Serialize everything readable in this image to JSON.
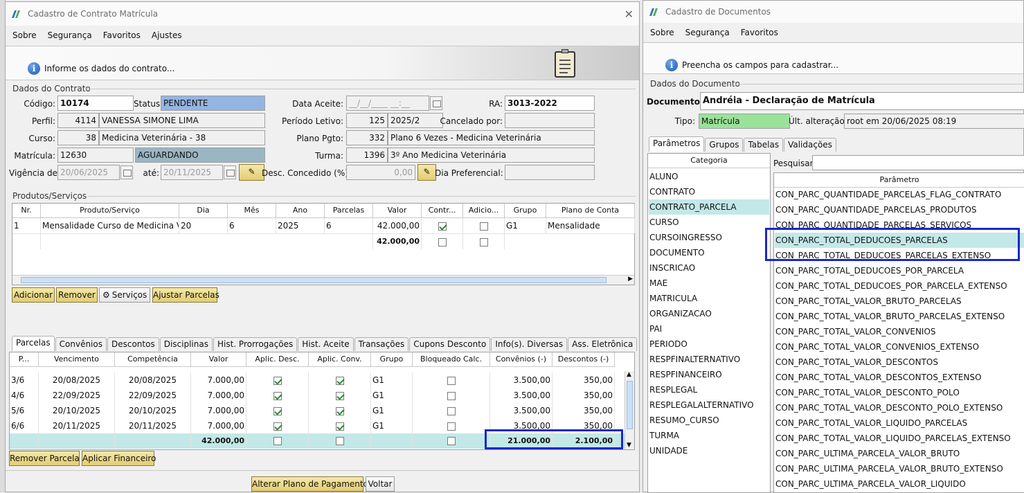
{
  "left": {
    "title": "Cadastro de Contrato Matrícula",
    "menu": [
      "Sobre",
      "Segurança",
      "Favoritos",
      "Ajustes"
    ],
    "banner": "Informe os dados do contrato...",
    "section_contract": "Dados do Contrato",
    "fields": {
      "codigo_label": "Código:",
      "codigo": "10174",
      "status_label": "Status:",
      "status": "PENDENTE",
      "data_aceite_label": "Data Aceite:",
      "data_aceite": "__/__/____ __:__",
      "ra_label": "RA:",
      "ra": "3013-2022",
      "perfil_label": "Perfil:",
      "perfil_id": "4114",
      "perfil_nome": "VANESSA SIMONE LIMA",
      "periodo_label": "Período Letivo:",
      "periodo_id": "125",
      "periodo": "2025/2",
      "cancelado_label": "Cancelado por:",
      "cancelado": "",
      "curso_label": "Curso:",
      "curso_id": "38",
      "curso": "Medicina Veterinária - 38",
      "plano_label": "Plano Pgto:",
      "plano_id": "332",
      "plano": "Plano 6 Vezes - Medicina Veterinária",
      "matricula_label": "Matrícula:",
      "matricula": "12630",
      "matricula_status": "AGUARDANDO",
      "turma_label": "Turma:",
      "turma_id": "1396",
      "turma": "3º Ano Medicina Veterinária",
      "vigencia_label": "Vigência de:",
      "vigencia_de": "20/06/2025",
      "ate_label": "até:",
      "vigencia_ate": "20/11/2025",
      "desc_label": "Desc. Concedido (%):",
      "desc": "0,00",
      "dia_pref_label": "Dia Preferencial:",
      "dia_pref": ""
    },
    "section_products": "Produtos/Serviços",
    "products_headers": [
      "Nr.",
      "Produto/Serviço",
      "Dia",
      "Mês",
      "Ano",
      "Parcelas",
      "Valor",
      "Contr...",
      "Adicio...",
      "Grupo",
      "Plano de Conta"
    ],
    "products_rows": [
      {
        "nr": "1",
        "produto": "Mensalidade Curso de Medicina Ve...",
        "dia": "20",
        "mes": "6",
        "ano": "2025",
        "parcelas": "6",
        "valor": "42.000,00",
        "contr": true,
        "adic": false,
        "grupo": "G1",
        "plano": "Mensalidade"
      }
    ],
    "products_total": "42.000,00",
    "product_buttons": [
      "Adicionar",
      "Remover",
      "Serviços",
      "Ajustar Parcelas"
    ],
    "tabs": [
      "Parcelas",
      "Convênios",
      "Descontos",
      "Disciplinas",
      "Hist. Prorrogações",
      "Hist. Aceite",
      "Transações",
      "Cupons Desconto",
      "Info(s). Diversas",
      "Ass. Eletrônica"
    ],
    "parcelas_headers": [
      "P...",
      "Vencimento",
      "Competência",
      "Valor",
      "Aplic. Desc.",
      "Aplic. Conv.",
      "Grupo",
      "Bloqueado Calc.",
      "Convênios (-)",
      "Descontos (-)"
    ],
    "parcelas_rows": [
      {
        "p": "3/6",
        "venc": "20/08/2025",
        "comp": "20/08/2025",
        "valor": "7.000,00",
        "desc": true,
        "conv": true,
        "grupo": "G1",
        "bloq": false,
        "convenios": "3.500,00",
        "descontos": "350,00"
      },
      {
        "p": "4/6",
        "venc": "22/09/2025",
        "comp": "22/09/2025",
        "valor": "7.000,00",
        "desc": true,
        "conv": true,
        "grupo": "G1",
        "bloq": false,
        "convenios": "3.500,00",
        "descontos": "350,00"
      },
      {
        "p": "5/6",
        "venc": "20/10/2025",
        "comp": "20/10/2025",
        "valor": "7.000,00",
        "desc": true,
        "conv": true,
        "grupo": "G1",
        "bloq": false,
        "convenios": "3.500,00",
        "descontos": "350,00"
      },
      {
        "p": "6/6",
        "venc": "20/11/2025",
        "comp": "20/11/2025",
        "valor": "7.000,00",
        "desc": true,
        "conv": true,
        "grupo": "G1",
        "bloq": false,
        "convenios": "3.500,00",
        "descontos": "350,00"
      }
    ],
    "parcelas_total": {
      "valor": "42.000,00",
      "convenios": "21.000,00",
      "descontos": "2.100,00"
    },
    "parcela_buttons": [
      "Remover Parcela",
      "Aplicar Financeiro"
    ],
    "footer_buttons": [
      "Alterar Plano de Pagamento",
      "Voltar"
    ]
  },
  "right": {
    "title": "Cadastro de Documentos",
    "menu": [
      "Sobre",
      "Segurança",
      "Favoritos"
    ],
    "banner": "Preencha os campos para cadastrar...",
    "section": "Dados do Documento",
    "documento_label": "Documento:",
    "documento": "Andréia - Declaração de Matrícula",
    "tipo_label": "Tipo:",
    "tipo": "Matrícula",
    "ult_label": "Últ. alteração:",
    "ult": "root em 20/06/2025 08:19",
    "tabs": [
      "Parâmetros",
      "Grupos",
      "Tabelas",
      "Validações"
    ],
    "categoria_header": "Categoria",
    "categorias": [
      "ALUNO",
      "CONTRATO",
      "CONTRATO_PARCELA",
      "CURSO",
      "CURSOINGRESSO",
      "DOCUMENTO",
      "INSCRICAO",
      "MAE",
      "MATRICULA",
      "ORGANIZACAO",
      "PAI",
      "PERIODO",
      "RESPFINALTERNATIVO",
      "RESPFINANCEIRO",
      "RESPLEGAL",
      "RESPLEGALALTERNATIVO",
      "RESUMO_CURSO",
      "TURMA",
      "UNIDADE"
    ],
    "pesquisar_label": "Pesquisar:",
    "parametro_header": "Parâmetro",
    "parametros": [
      "CON_PARC_QUANTIDADE_PARCELAS_FLAG_CONTRATO",
      "CON_PARC_QUANTIDADE_PARCELAS_PRODUTOS",
      "CON_PARC_QUANTIDADE_PARCELAS_SERVICOS",
      "CON_PARC_TOTAL_DEDUCOES_PARCELAS",
      "CON_PARC_TOTAL_DEDUCOES_PARCELAS_EXTENSO",
      "CON_PARC_TOTAL_DEDUCOES_POR_PARCELA",
      "CON_PARC_TOTAL_DEDUCOES_POR_PARCELA_EXTENSO",
      "CON_PARC_TOTAL_VALOR_BRUTO_PARCELAS",
      "CON_PARC_TOTAL_VALOR_BRUTO_PARCELAS_EXTENSO",
      "CON_PARC_TOTAL_VALOR_CONVENIOS",
      "CON_PARC_TOTAL_VALOR_CONVENIOS_EXTENSO",
      "CON_PARC_TOTAL_VALOR_DESCONTOS",
      "CON_PARC_TOTAL_VALOR_DESCONTOS_EXTENSO",
      "CON_PARC_TOTAL_VALOR_DESCONTO_POLO",
      "CON_PARC_TOTAL_VALOR_DESCONTO_POLO_EXTENSO",
      "CON_PARC_TOTAL_VALOR_LIQUIDO_PARCELAS",
      "CON_PARC_TOTAL_VALOR_LIQUIDO_PARCELAS_EXTENSO",
      "CON_PARC_ULTIMA_PARCELA_VALOR_BRUTO",
      "CON_PARC_ULTIMA_PARCELA_VALOR_BRUTO_EXTENSO",
      "CON_PARC_ULTIMA_PARCELA_VALOR_LIQUIDO"
    ]
  }
}
